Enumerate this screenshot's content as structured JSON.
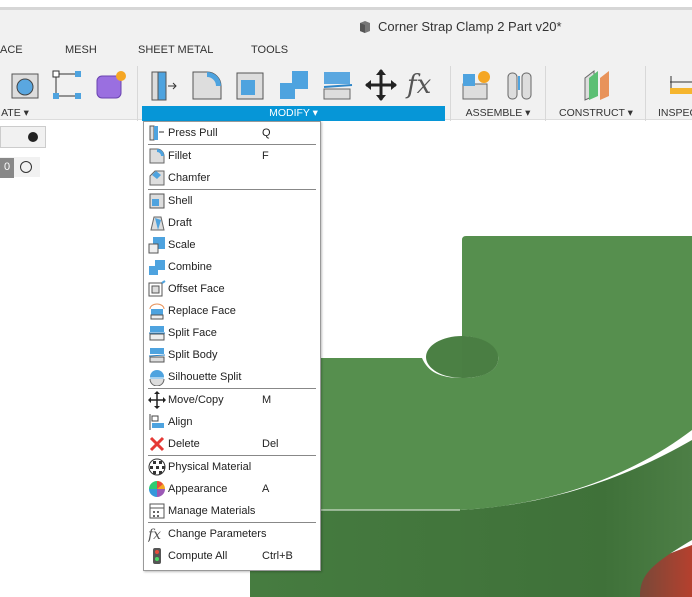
{
  "title": "Corner Strap Clamp 2 Part v20*",
  "tabs": [
    "ACE",
    "MESH",
    "SHEET METAL",
    "TOOLS"
  ],
  "groups": {
    "create": "ATE ▾",
    "modify": "MODIFY ▾",
    "assemble": "ASSEMBLE ▾",
    "construct": "CONSTRUCT ▾",
    "inspect": "INSPEC"
  },
  "left_panel": {
    "value": "0"
  },
  "menu": [
    {
      "label": "Press Pull",
      "shortcut": "Q",
      "icon": "press-pull-icon"
    },
    {
      "sep": true
    },
    {
      "label": "Fillet",
      "shortcut": "F",
      "icon": "fillet-icon"
    },
    {
      "label": "Chamfer",
      "shortcut": "",
      "icon": "chamfer-icon"
    },
    {
      "sep": true
    },
    {
      "label": "Shell",
      "shortcut": "",
      "icon": "shell-icon"
    },
    {
      "label": "Draft",
      "shortcut": "",
      "icon": "draft-icon"
    },
    {
      "label": "Scale",
      "shortcut": "",
      "icon": "scale-icon"
    },
    {
      "label": "Combine",
      "shortcut": "",
      "icon": "combine-icon"
    },
    {
      "label": "Offset Face",
      "shortcut": "",
      "icon": "offset-face-icon"
    },
    {
      "label": "Replace Face",
      "shortcut": "",
      "icon": "replace-face-icon"
    },
    {
      "label": "Split Face",
      "shortcut": "",
      "icon": "split-face-icon"
    },
    {
      "label": "Split Body",
      "shortcut": "",
      "icon": "split-body-icon"
    },
    {
      "label": "Silhouette Split",
      "shortcut": "",
      "icon": "silhouette-split-icon"
    },
    {
      "sep": true
    },
    {
      "label": "Move/Copy",
      "shortcut": "M",
      "icon": "move-icon"
    },
    {
      "label": "Align",
      "shortcut": "",
      "icon": "align-icon"
    },
    {
      "label": "Delete",
      "shortcut": "Del",
      "icon": "delete-icon"
    },
    {
      "sep": true
    },
    {
      "label": "Physical Material",
      "shortcut": "",
      "icon": "physical-material-icon"
    },
    {
      "label": "Appearance",
      "shortcut": "A",
      "icon": "appearance-icon"
    },
    {
      "label": "Manage Materials",
      "shortcut": "",
      "icon": "manage-materials-icon"
    },
    {
      "sep": true
    },
    {
      "label": "Change Parameters",
      "shortcut": "",
      "icon": "fx-icon"
    },
    {
      "label": "Compute All",
      "shortcut": "Ctrl+B",
      "icon": "compute-all-icon"
    }
  ],
  "colors": {
    "accent": "#0696d7",
    "model": "#548f4d",
    "model_side": "#457a40"
  }
}
